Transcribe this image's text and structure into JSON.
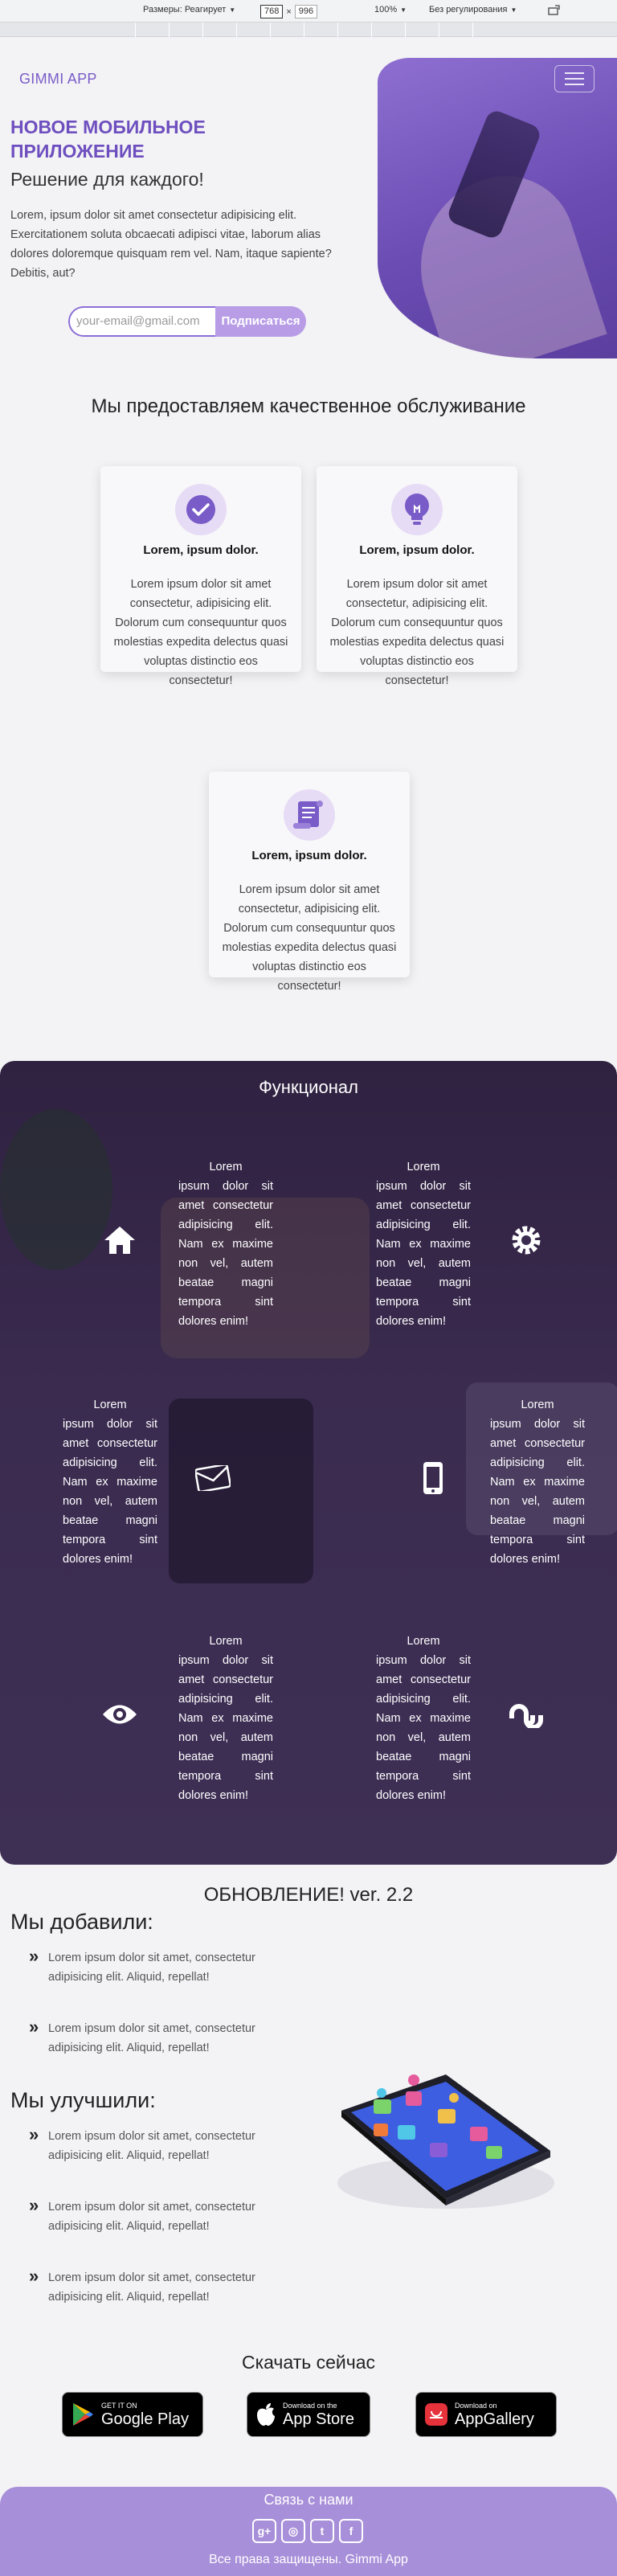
{
  "devtools": {
    "dimensions_label": "Размеры: Реагирует",
    "width_value": "768",
    "times": "×",
    "height_value": "996",
    "zoom": "100%",
    "throttling": "Без регулирования"
  },
  "header": {
    "brand": "GIMMI APP"
  },
  "hero": {
    "title": "НОВОЕ МОБИЛЬНОЕ ПРИЛОЖЕНИЕ",
    "subtitle": "Решение для каждого!",
    "text": "Lorem, ipsum dolor sit amet consectetur adipisicing elit. Exercitationem soluta obcaecati adipisci vitae, laborum alias dolores doloremque quisquam rem vel. Nam, itaque sapiente? Debitis, aut?",
    "email_placeholder": "your-email@gmail.com",
    "subscribe_label": "Подписаться"
  },
  "services": {
    "title": "Мы предоставляем качественное обслуживание",
    "cards": [
      {
        "icon": "check-icon",
        "heading": "Lorem, ipsum dolor.",
        "text": "Lorem ipsum dolor sit amet consectetur, adipisicing elit. Dolorum cum consequuntur quos molestias expedita delectus quasi voluptas distinctio eos consectetur!"
      },
      {
        "icon": "lightbulb-icon",
        "heading": "Lorem, ipsum dolor.",
        "text": "Lorem ipsum dolor sit amet consectetur, adipisicing elit. Dolorum cum consequuntur quos molestias expedita delectus quasi voluptas distinctio eos consectetur!"
      },
      {
        "icon": "scroll-icon",
        "heading": "Lorem, ipsum dolor.",
        "text": "Lorem ipsum dolor sit amet consectetur, adipisicing elit. Dolorum cum consequuntur quos molestias expedita delectus quasi voluptas distinctio eos consectetur!"
      }
    ]
  },
  "features": {
    "title": "Функционал",
    "items": [
      {
        "icon": "home-icon",
        "lead": "Lorem",
        "text": "ipsum dolor sit amet consectetur adipisicing elit. Nam ex maxime non vel, autem beatae magni tempora sint dolores enim!"
      },
      {
        "icon": "gear-icon",
        "lead": "Lorem",
        "text": "ipsum dolor sit amet consectetur adipisicing elit. Nam ex maxime non vel, autem beatae magni tempora sint dolores enim!"
      },
      {
        "icon": "envelope-icon",
        "lead": "Lorem",
        "text": "ipsum dolor sit amet consectetur adipisicing elit. Nam ex maxime non vel, autem beatae magni tempora sint dolores enim!"
      },
      {
        "icon": "mobile-icon",
        "lead": "Lorem",
        "text": "ipsum dolor sit amet consectetur adipisicing elit. Nam ex maxime non vel, autem beatae magni tempora sint dolores enim!"
      },
      {
        "icon": "eye-icon",
        "lead": "Lorem",
        "text": "ipsum dolor sit amet consectetur adipisicing elit. Nam ex maxime non vel, autem beatae magni tempora sint dolores enim!"
      },
      {
        "icon": "stumbleupon-icon",
        "lead": "Lorem",
        "text": "ipsum dolor sit amet consectetur adipisicing elit. Nam ex maxime non vel, autem beatae magni tempora sint dolores enim!"
      }
    ]
  },
  "update": {
    "title": "ОБНОВЛЕНИЕ! ver. 2.2",
    "added_heading": "Мы добавили:",
    "added": [
      "Lorem ipsum dolor sit amet, consectetur adipisicing elit. Aliquid, repellat!",
      "Lorem ipsum dolor sit amet, consectetur adipisicing elit. Aliquid, repellat!"
    ],
    "improved_heading": "Мы улучшили:",
    "improved": [
      "Lorem ipsum dolor sit amet, consectetur adipisicing elit. Aliquid, repellat!",
      "Lorem ipsum dolor sit amet, consectetur adipisicing elit. Aliquid, repellat!",
      "Lorem ipsum dolor sit amet, consectetur adipisicing elit. Aliquid, repellat!"
    ],
    "bullet": "»"
  },
  "download": {
    "title": "Скачать сейчас",
    "stores": [
      {
        "icon": "google-play-icon",
        "small": "GET IT ON",
        "big": "Google Play"
      },
      {
        "icon": "apple-icon",
        "small": "Download on the",
        "big": "App Store"
      },
      {
        "icon": "huawei-icon",
        "small": "Download on",
        "big": "AppGallery"
      }
    ]
  },
  "footer": {
    "contact": "Связь с нами",
    "social": [
      {
        "icon": "google-plus-icon",
        "glyph": "g+"
      },
      {
        "icon": "instagram-icon",
        "glyph": "◎"
      },
      {
        "icon": "twitter-icon",
        "glyph": "t"
      },
      {
        "icon": "facebook-icon",
        "glyph": "f"
      }
    ],
    "copyright": "Все права защищены. Gimmi App"
  },
  "colors": {
    "accent": "#7a5cc8",
    "accent_light": "#b89de6",
    "features_bg": "#33253f",
    "footer_bg": "#a88fd9"
  }
}
